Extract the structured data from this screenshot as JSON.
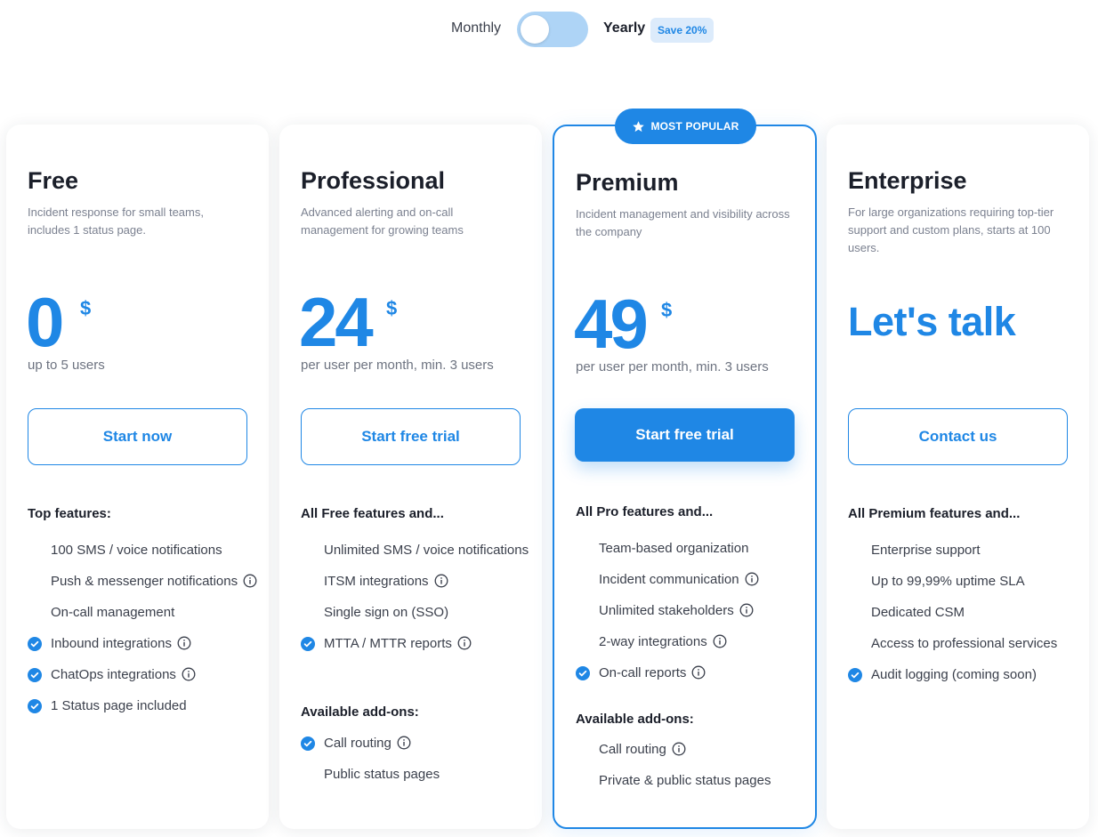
{
  "billing": {
    "monthly": "Monthly",
    "yearly": "Yearly",
    "save": "Save 20%"
  },
  "colors": {
    "accent": "#1f87e5",
    "toggle_track": "#aed4f6",
    "save_bg": "#dcebfb"
  },
  "plans": [
    {
      "name": "Free",
      "desc": "Incident response for small teams, includes 1 status page.",
      "price": "0",
      "currency": "$",
      "price_sub": "up to 5 users",
      "cta": "Start now",
      "sections": [
        {
          "heading": "Top features:",
          "items": [
            {
              "text": "100 SMS / voice notifications",
              "check": false,
              "info": false
            },
            {
              "text": "Push & messenger notifications",
              "check": false,
              "info": true
            },
            {
              "text": "On-call management",
              "check": false,
              "info": false
            },
            {
              "text": "Inbound integrations",
              "check": true,
              "info": true
            },
            {
              "text": "ChatOps integrations",
              "check": true,
              "info": true
            },
            {
              "text": "1 Status page included",
              "check": true,
              "info": false
            }
          ]
        }
      ]
    },
    {
      "name": "Professional",
      "desc": "Advanced alerting and on-call management for growing teams",
      "price": "24",
      "currency": "$",
      "price_sub": "per user per month, min. 3 users",
      "cta": "Start free trial",
      "sections": [
        {
          "heading": "All Free features and...",
          "items": [
            {
              "text": "Unlimited SMS / voice notifications",
              "check": false,
              "info": false
            },
            {
              "text": "ITSM integrations",
              "check": false,
              "info": true
            },
            {
              "text": "Single sign on (SSO)",
              "check": false,
              "info": false
            },
            {
              "text": "MTTA / MTTR reports",
              "check": true,
              "info": true
            }
          ]
        },
        {
          "heading": "Available add-ons:",
          "items": [
            {
              "text": "Call routing",
              "check": true,
              "info": true
            },
            {
              "text": "Public status pages",
              "check": false,
              "info": false
            }
          ]
        }
      ]
    },
    {
      "name": "Premium",
      "badge": "MOST POPULAR",
      "desc": "Incident management and visibility across the company",
      "price": "49",
      "currency": "$",
      "price_sub": "per user per month, min. 3 users",
      "cta": "Start free trial",
      "sections": [
        {
          "heading": "All Pro features and...",
          "items": [
            {
              "text": "Team-based organization",
              "check": false,
              "info": false
            },
            {
              "text": "Incident communication",
              "check": false,
              "info": true
            },
            {
              "text": "Unlimited stakeholders",
              "check": false,
              "info": true
            },
            {
              "text": "2-way integrations",
              "check": false,
              "info": true
            },
            {
              "text": "On-call reports",
              "check": true,
              "info": true
            }
          ]
        },
        {
          "heading": "Available add-ons:",
          "items": [
            {
              "text": "Call routing",
              "check": false,
              "info": true
            },
            {
              "text": "Private & public status pages",
              "check": false,
              "info": false
            }
          ]
        }
      ]
    },
    {
      "name": "Enterprise",
      "desc": "For large organizations requiring top-tier support and custom plans, starts at 100 users.",
      "price_text": "Let's talk",
      "cta": "Contact us",
      "sections": [
        {
          "heading": "All Premium features and...",
          "items": [
            {
              "text": "Enterprise support",
              "check": false,
              "info": false
            },
            {
              "text": "Up to 99,99% uptime SLA",
              "check": false,
              "info": false
            },
            {
              "text": "Dedicated CSM",
              "check": false,
              "info": false
            },
            {
              "text": "Access to professional services",
              "check": false,
              "info": false
            },
            {
              "text": "Audit logging (coming soon)",
              "check": true,
              "info": false
            }
          ]
        }
      ]
    }
  ]
}
